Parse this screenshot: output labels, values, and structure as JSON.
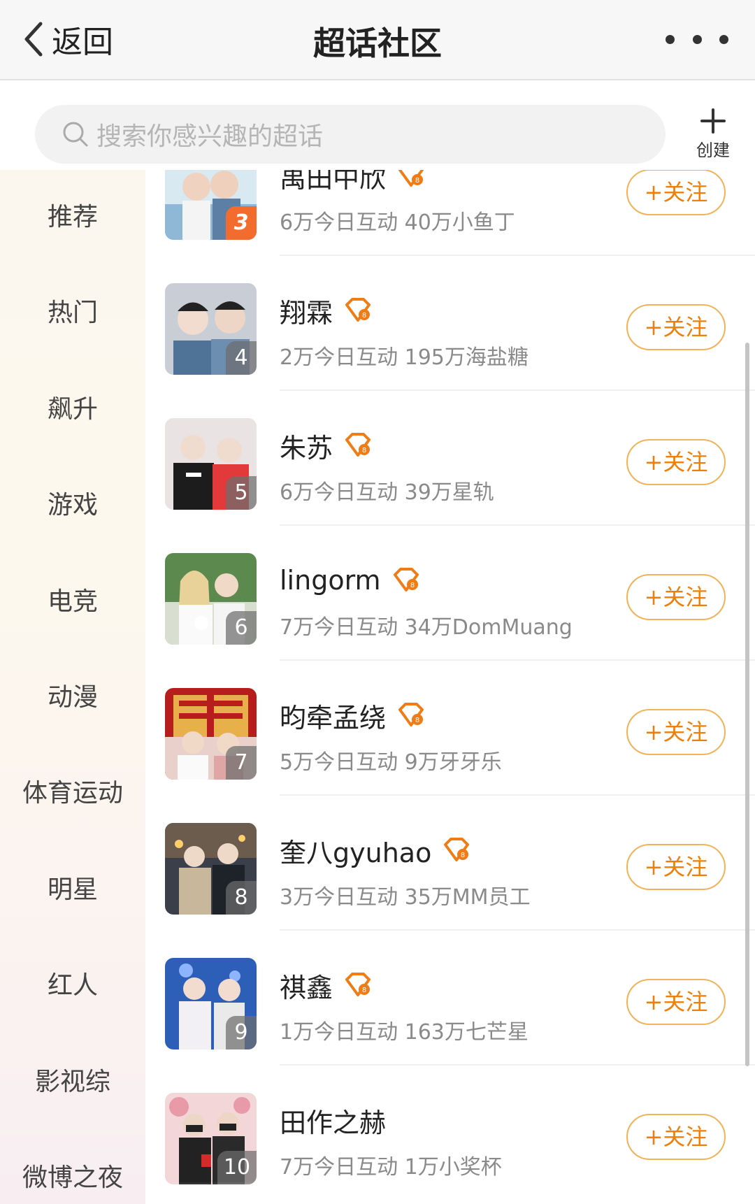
{
  "header": {
    "back_label": "返回",
    "title": "超话社区"
  },
  "search": {
    "placeholder": "搜索你感兴趣的超话",
    "create_label": "创建"
  },
  "categories": [
    "推荐",
    "热门",
    "飙升",
    "游戏",
    "电竞",
    "动漫",
    "体育运动",
    "明星",
    "红人",
    "影视综",
    "微博之夜"
  ],
  "communities": [
    {
      "rank": "3",
      "name": "禹田中欣",
      "stats": "6万今日互动 40万小鱼丁",
      "follow": "+关注"
    },
    {
      "rank": "4",
      "name": "翔霖",
      "stats": "2万今日互动 195万海盐糖",
      "follow": "+关注"
    },
    {
      "rank": "5",
      "name": "朱苏",
      "stats": "6万今日互动 39万星轨",
      "follow": "+关注"
    },
    {
      "rank": "6",
      "name": "lingorm",
      "stats": "7万今日互动 34万DomMuang",
      "follow": "+关注"
    },
    {
      "rank": "7",
      "name": "昀牵孟绕",
      "stats": "5万今日互动 9万牙牙乐",
      "follow": "+关注"
    },
    {
      "rank": "8",
      "name": "奎八gyuhao",
      "stats": "3万今日互动 35万MM员工",
      "follow": "+关注"
    },
    {
      "rank": "9",
      "name": "祺鑫",
      "stats": "1万今日互动 163万七芒星",
      "follow": "+关注"
    },
    {
      "rank": "10",
      "name": "田作之赫",
      "stats": "7万今日互动 1万小奖杯",
      "follow": "+关注"
    }
  ],
  "colors": {
    "accent": "#ee7f0a",
    "follow_border": "#f2b259",
    "top_rank": "#f46b2e"
  },
  "icons": {
    "back": "chevron-left-icon",
    "more": "more-dots-icon",
    "search": "search-icon",
    "create": "plus-icon",
    "badge": "diamond-badge-icon"
  }
}
